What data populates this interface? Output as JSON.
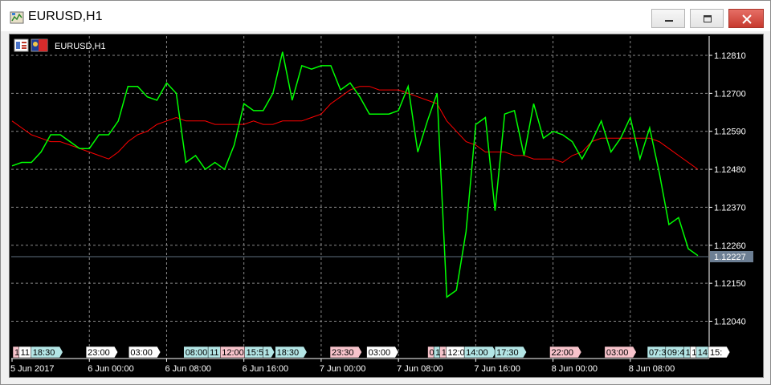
{
  "window": {
    "title": "EURUSD,H1",
    "icon": "chart-app-icon",
    "controls": [
      "minimize-icon",
      "maximize-icon",
      "close-icon"
    ]
  },
  "chart": {
    "label": "EURUSD,H1",
    "label_icons": [
      "templates-icon",
      "flag-icon"
    ],
    "current_price": "1.12227"
  },
  "chart_data": {
    "type": "line",
    "symbol": "EURUSD",
    "timeframe": "H1",
    "ylim": [
      1.1196,
      1.1288
    ],
    "y_ticks": [
      "1.12810",
      "1.12700",
      "1.12590",
      "1.12480",
      "1.12370",
      "1.12260",
      "1.12150",
      "1.12040"
    ],
    "y_tick_values": [
      1.1281,
      1.127,
      1.1259,
      1.1248,
      1.1237,
      1.1226,
      1.1215,
      1.1204
    ],
    "x_ticks": [
      "5 Jun 2017",
      "6 Jun 00:00",
      "6 Jun 08:00",
      "6 Jun 16:00",
      "7 Jun 00:00",
      "7 Jun 08:00",
      "7 Jun 16:00",
      "8 Jun 00:00",
      "8 Jun 08:00"
    ],
    "x_tick_index": [
      0,
      8,
      16,
      24,
      32,
      40,
      48,
      56,
      64
    ],
    "grid": true,
    "series": [
      {
        "color": "#00ff00",
        "values": [
          1.1249,
          1.125,
          1.125,
          1.1253,
          1.1258,
          1.1258,
          1.1256,
          1.1254,
          1.1254,
          1.1258,
          1.1258,
          1.1262,
          1.1272,
          1.1272,
          1.1269,
          1.1268,
          1.1273,
          1.127,
          1.125,
          1.1252,
          1.1248,
          1.125,
          1.1248,
          1.1255,
          1.1267,
          1.1265,
          1.1265,
          1.127,
          1.1282,
          1.1268,
          1.1278,
          1.1277,
          1.1278,
          1.1278,
          1.1271,
          1.1273,
          1.1269,
          1.1264,
          1.1264,
          1.1264,
          1.1265,
          1.1272,
          1.1253,
          1.1262,
          1.127,
          1.1211,
          1.1213,
          1.123,
          1.1261,
          1.1263,
          1.1236,
          1.1264,
          1.1265,
          1.1252,
          1.1267,
          1.1257,
          1.1259,
          1.1258,
          1.1256,
          1.1251,
          1.1256,
          1.1262,
          1.1253,
          1.1257,
          1.1263,
          1.1251,
          1.126,
          1.1247,
          1.1232,
          1.1234,
          1.1225,
          1.1223
        ]
      },
      {
        "color": "#ff0000",
        "values": [
          1.1262,
          1.126,
          1.1258,
          1.1257,
          1.1256,
          1.1256,
          1.1255,
          1.1254,
          1.1253,
          1.1252,
          1.1251,
          1.1253,
          1.1256,
          1.1258,
          1.1259,
          1.1261,
          1.1262,
          1.1263,
          1.1262,
          1.1262,
          1.1262,
          1.1261,
          1.1261,
          1.1261,
          1.1261,
          1.1262,
          1.1261,
          1.1261,
          1.1262,
          1.1262,
          1.1262,
          1.1263,
          1.1264,
          1.1267,
          1.1269,
          1.1271,
          1.1272,
          1.1272,
          1.1271,
          1.1271,
          1.1271,
          1.127,
          1.1269,
          1.1268,
          1.1267,
          1.1262,
          1.1259,
          1.1256,
          1.1255,
          1.1253,
          1.1253,
          1.1253,
          1.1252,
          1.1252,
          1.1251,
          1.1251,
          1.1251,
          1.125,
          1.1252,
          1.1253,
          1.1256,
          1.1257,
          1.1257,
          1.1257,
          1.1257,
          1.1257,
          1.1257,
          1.1256,
          1.1254,
          1.1252,
          1.125,
          1.1248
        ]
      }
    ],
    "event_labels": [
      {
        "text": "16",
        "color": "#f7c3cb",
        "index": 0
      },
      {
        "text": "11",
        "color": "#ffffff",
        "index": 1
      },
      {
        "text": "18:30",
        "color": "#b3e5e5",
        "index": 3
      },
      {
        "text": "23:00",
        "color": "#ffffff",
        "index": 12
      },
      {
        "text": "03:00",
        "color": "#ffffff",
        "index": 19
      },
      {
        "text": "08:00",
        "color": "#b3e5e5",
        "index": 28
      },
      {
        "text": "11",
        "color": "#b3e5e5",
        "index": 32
      },
      {
        "text": "12:00",
        "color": "#f7c3cb",
        "index": 34
      },
      {
        "text": "15:5",
        "color": "#b3e5e5",
        "index": 38
      },
      {
        "text": "1",
        "color": "#b3e5e5",
        "index": 41
      },
      {
        "text": "18:30",
        "color": "#b3e5e5",
        "index": 43
      },
      {
        "text": "23:30",
        "color": "#f7c3cb",
        "index": 52
      },
      {
        "text": "03:00",
        "color": "#ffffff",
        "index": 58
      },
      {
        "text": "09",
        "color": "#f7c3cb",
        "index": 68
      },
      {
        "text": "10",
        "color": "#b3e5e5",
        "index": 69
      },
      {
        "text": "1",
        "color": "#f7c3cb",
        "index": 70
      },
      {
        "text": "12:0",
        "color": "#ffffff",
        "index": 71
      },
      {
        "text": "14:00",
        "color": "#b3e5e5",
        "index": 74
      },
      {
        "text": "17:30",
        "color": "#b3e5e5",
        "index": 79
      },
      {
        "text": "22:00",
        "color": "#f7c3cb",
        "index": 88
      },
      {
        "text": "03:00",
        "color": "#f7c3cb",
        "index": 97
      },
      {
        "text": "07:3",
        "color": "#b3e5e5",
        "index": 104
      },
      {
        "text": "09:45",
        "color": "#b3e5e5",
        "index": 107
      },
      {
        "text": "11",
        "color": "#b3e5e5",
        "index": 110
      },
      {
        "text": "13",
        "color": "#ffffff",
        "index": 111
      },
      {
        "text": "14",
        "color": "#b3e5e5",
        "index": 112
      },
      {
        "text": "15:",
        "color": "#ffffff",
        "index": 114
      }
    ],
    "current_price_value": 1.12227
  }
}
